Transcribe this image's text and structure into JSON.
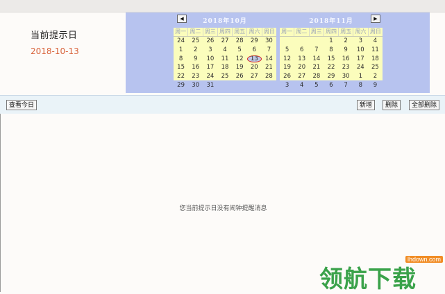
{
  "reminder": {
    "title": "当前提示日",
    "date": "2018-10-13"
  },
  "calendar": {
    "weekdays": [
      "周一",
      "周二",
      "周三",
      "周四",
      "周五",
      "周六",
      "周日"
    ],
    "months": [
      {
        "title": "2018年10月",
        "nav": "◀",
        "weeks": [
          [
            "24",
            "25",
            "26",
            "27",
            "28",
            "29",
            "30"
          ],
          [
            "1",
            "2",
            "3",
            "4",
            "5",
            "6",
            "7"
          ],
          [
            "8",
            "9",
            "10",
            "11",
            "12",
            "13",
            "14"
          ],
          [
            "15",
            "16",
            "17",
            "18",
            "19",
            "20",
            "21"
          ],
          [
            "22",
            "23",
            "24",
            "25",
            "26",
            "27",
            "28"
          ],
          [
            "29",
            "30",
            "31",
            "",
            "",
            "",
            ""
          ]
        ],
        "selected": "13"
      },
      {
        "title": "2018年11月",
        "nav": "▶",
        "weeks": [
          [
            "",
            "",
            "",
            "1",
            "2",
            "3",
            "4"
          ],
          [
            "5",
            "6",
            "7",
            "8",
            "9",
            "10",
            "11"
          ],
          [
            "12",
            "13",
            "14",
            "15",
            "16",
            "17",
            "18"
          ],
          [
            "19",
            "20",
            "21",
            "22",
            "23",
            "24",
            "25"
          ],
          [
            "26",
            "27",
            "28",
            "29",
            "30",
            "1",
            "2"
          ],
          [
            "3",
            "4",
            "5",
            "6",
            "7",
            "8",
            "9"
          ]
        ]
      }
    ]
  },
  "toolbar": {
    "today_label": "查看今日",
    "add_label": "新增",
    "delete_label": "删除",
    "delete_all_label": "全部删除"
  },
  "content": {
    "empty_message": "您当前提示日没有闹钟提醒消息"
  },
  "watermark": {
    "url": "lhdown.com",
    "name": "领航下载"
  },
  "colors": {
    "calendar_bg": "#b7c3ef",
    "grid_bg": "#fbfdbc",
    "toolbar_bg": "#eaf3f8",
    "date_text": "#d8623a",
    "selection": "#d52222"
  }
}
